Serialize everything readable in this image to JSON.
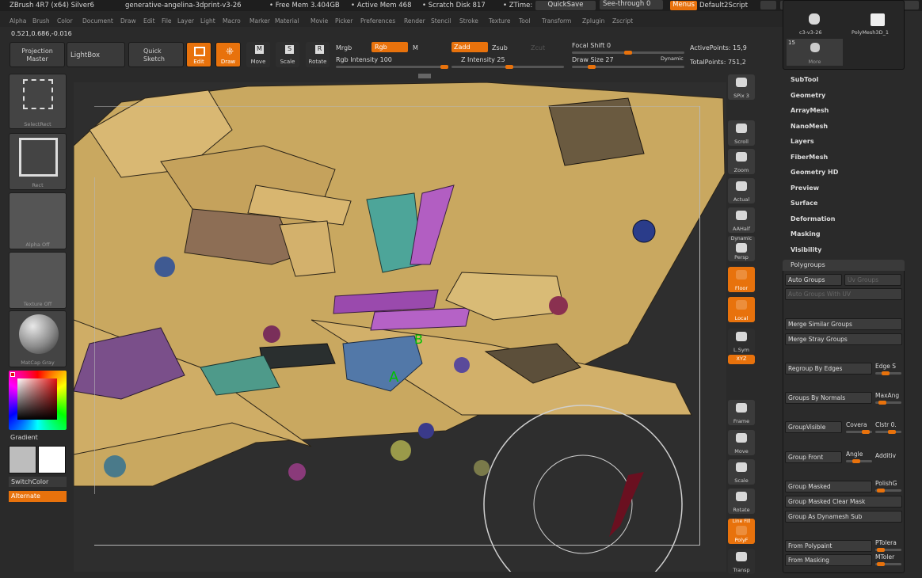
{
  "titlebar": {
    "app": "ZBrush 4R7 (x64) Silver6",
    "file": "generative-angelina-3dprint-v3-26",
    "free_mem": "• Free Mem 3.404GB",
    "active_mem": "• Active Mem 468",
    "scratch": "• Scratch Disk 817",
    "ztime": "• ZTime:",
    "quicksave": "QuickSave",
    "see_through": "See-through  0",
    "menus": "Menus",
    "script": "Default2Script"
  },
  "menubar": [
    "Alpha",
    "Brush",
    "Color",
    "Document",
    "Draw",
    "Edit",
    "File",
    "Layer",
    "Light",
    "Macro",
    "Marker",
    "Material",
    "Movie",
    "Picker",
    "Preferences",
    "Render",
    "Stencil",
    "Stroke",
    "Texture",
    "Tool",
    "Transform",
    "Zplugin",
    "Zscript"
  ],
  "coords": "0.521,0.686,-0.016",
  "toolbar": {
    "projection_master": "Projection\nMaster",
    "lightbox": "LightBox",
    "quick_sketch": "Quick\nSketch",
    "edit": "Edit",
    "draw": "Draw",
    "move": "Move",
    "scale": "Scale",
    "rotate": "Rotate",
    "mrgb": "Mrgb",
    "rgb": "Rgb",
    "m": "M",
    "rgb_intensity": "Rgb Intensity 100",
    "zadd": "Zadd",
    "zsub": "Zsub",
    "zcut": "Zcut",
    "z_intensity": "Z Intensity 25",
    "focal_shift": "Focal Shift 0",
    "draw_size": "Draw Size 27",
    "dynamic": "Dynamic",
    "active_points": "ActivePoints: 15,9",
    "total_points": "TotalPoints: 751,2"
  },
  "left": {
    "tile1": "SelectRect",
    "tile2": "Rect",
    "tile3": "Alpha Off",
    "tile4": "Texture Off",
    "tile5": "MatCap Gray",
    "gradient": "Gradient",
    "switchcolor": "SwitchColor",
    "alternate": "Alternate"
  },
  "right_toolbar": [
    {
      "label": "SPix 3",
      "name": "spix-button"
    },
    {
      "label": "Scroll",
      "name": "scroll-button"
    },
    {
      "label": "Zoom",
      "name": "zoom-button"
    },
    {
      "label": "Actual",
      "name": "actual-button"
    },
    {
      "label": "AAHalf",
      "name": "aahalf-button"
    },
    {
      "label": "Persp",
      "name": "persp-button",
      "top": "Dynamic"
    },
    {
      "label": "Floor",
      "name": "floor-button"
    },
    {
      "label": "Local",
      "name": "local-button"
    },
    {
      "label": "L.Sym",
      "name": "lsym-button"
    },
    {
      "label": "XYZ",
      "name": "xyz-button"
    },
    {
      "label": "Frame",
      "name": "frame-button"
    },
    {
      "label": "Move",
      "name": "move-view-button"
    },
    {
      "label": "Scale",
      "name": "scale-view-button"
    },
    {
      "label": "Rotate",
      "name": "rotate-view-button"
    },
    {
      "label": "PolyF",
      "name": "polyf-button",
      "top": "Line Fill"
    },
    {
      "label": "Transp",
      "name": "transp-button"
    }
  ],
  "tool_thumbs": {
    "t1": "c3-v3-26",
    "t2": "PolyMesh3D_1",
    "count": "15",
    "more": "More"
  },
  "subpalettes": [
    "SubTool",
    "Geometry",
    "ArrayMesh",
    "NanoMesh",
    "Layers",
    "FiberMesh",
    "Geometry HD",
    "Preview",
    "Surface",
    "Deformation",
    "Masking",
    "Visibility"
  ],
  "polygroups": {
    "header": "Polygroups",
    "auto_groups": "Auto Groups",
    "uv_groups": "Uv Groups",
    "auto_groups_uv": "Auto Groups With UV",
    "merge_similar": "Merge Similar Groups",
    "merge_stray": "Merge Stray Groups",
    "regroup_edges": "Regroup By Edges",
    "edge_s": "Edge S",
    "by_normals": "Groups By Normals",
    "maxang": "MaxAng",
    "groupvisible": "GroupVisible",
    "coverage": "Covera",
    "clstr": "Clstr 0.",
    "group_front": "Group Front",
    "angle": "Angle",
    "additive": "Additiv",
    "group_masked": "Group Masked",
    "polishg": "PolishG",
    "masked_clear": "Group Masked Clear Mask",
    "as_dynamesh": "Group As Dynamesh Sub",
    "from_polypaint": "From Polypaint",
    "ptolera": "PTolera",
    "from_masking": "From Masking",
    "mtolera": "MToler"
  },
  "colors": {
    "accent": "#e8720c",
    "canvas": "#2e2e2e",
    "mesh": "#d6b36a",
    "teal": "#4aa095",
    "purple": "#a85ab8",
    "blue": "#4e6e9e"
  }
}
